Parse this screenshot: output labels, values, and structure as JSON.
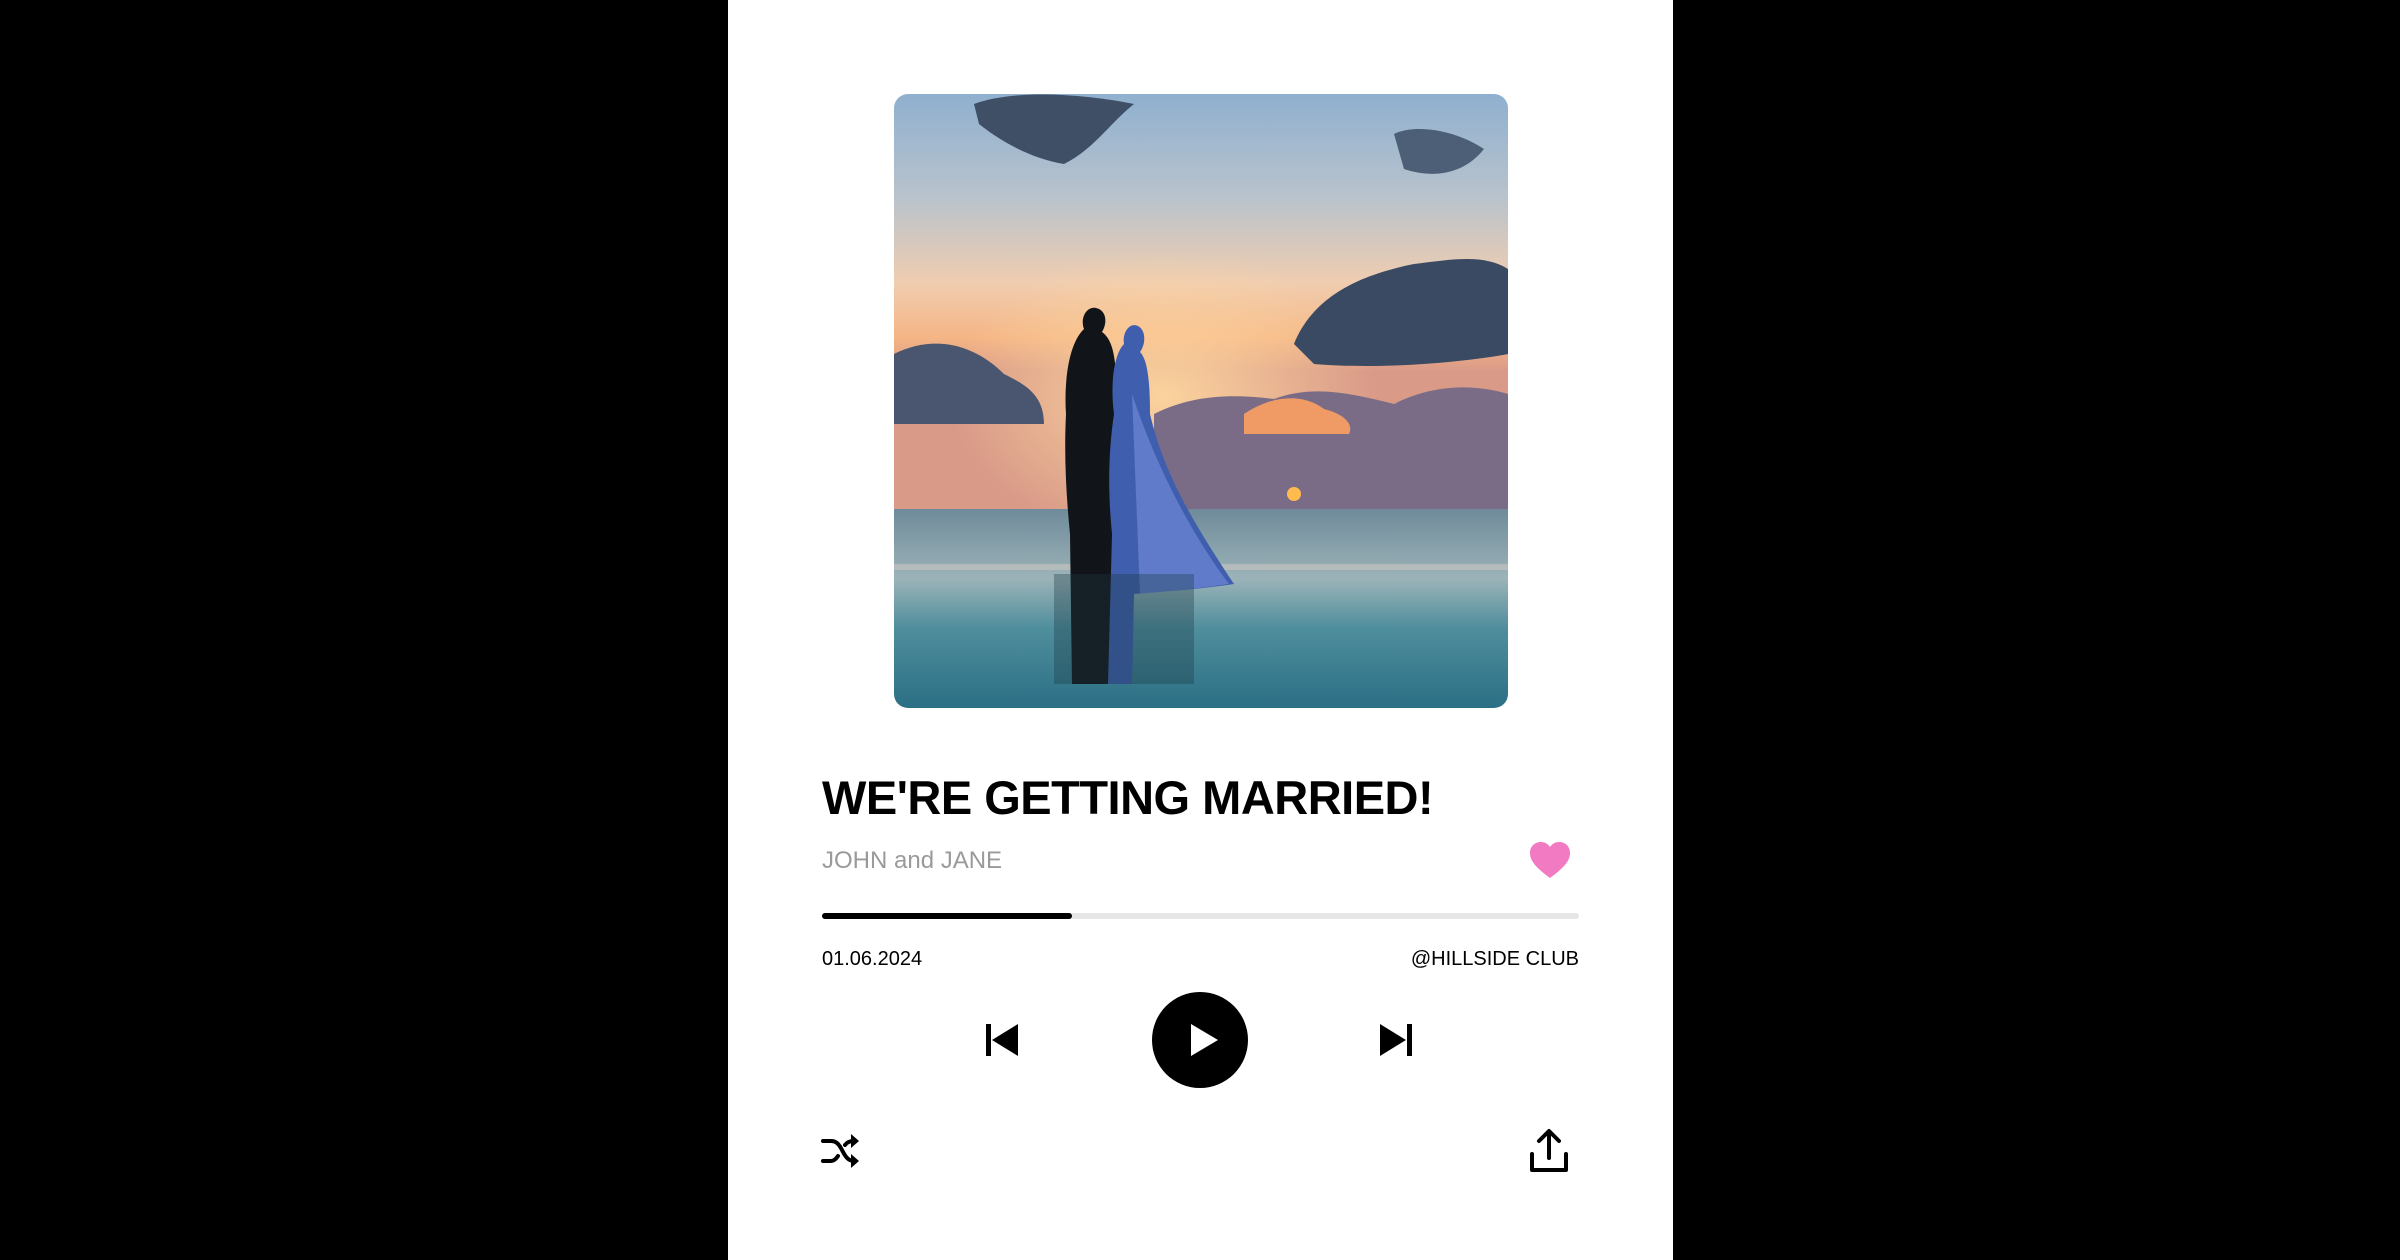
{
  "player": {
    "title": "WE'RE GETTING MARRIED!",
    "artist": "JOHN and JANE",
    "progress_fraction": 0.33,
    "date": "01.06.2024",
    "venue": "@HILLSIDE CLUB",
    "liked": true
  },
  "icons": {
    "heart": "heart-icon",
    "previous": "skip-previous-icon",
    "play": "play-icon",
    "next": "skip-next-icon",
    "shuffle": "shuffle-icon",
    "share": "share-upload-icon"
  },
  "colors": {
    "background": "#000000",
    "card": "#ffffff",
    "heart": "#f27ac3",
    "artist_text": "#9a9a9a",
    "progress_track": "#e6e6e6",
    "progress_fill": "#000000"
  }
}
